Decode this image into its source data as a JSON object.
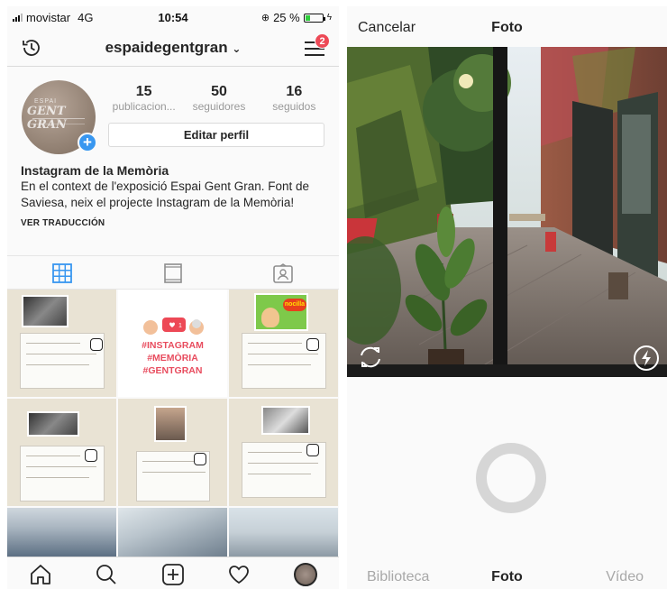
{
  "status_bar": {
    "carrier": "movistar",
    "network": "4G",
    "time": "10:54",
    "battery_percent": "25 %",
    "battery_level": 0.25
  },
  "profile": {
    "username": "espaidegentgran",
    "notification_count": "2",
    "avatar_text_top": "ESPAI",
    "avatar_text_main": "GENT GRAN",
    "stats": [
      {
        "count": "15",
        "label": "publicacion..."
      },
      {
        "count": "50",
        "label": "seguidores"
      },
      {
        "count": "16",
        "label": "seguidos"
      }
    ],
    "edit_button": "Editar perfil",
    "display_name": "Instagram de la Memòria",
    "bio": "En el context de l'exposició Espai Gent Gran. Font de Saviesa, neix el projecte Instagram de la Memòria!",
    "translate_link": "VER TRADUCCIÓN"
  },
  "grid": {
    "post_hashtags": [
      "#INSTAGRAM",
      "#MEMÒRIA",
      "#GENTGRAN"
    ],
    "post_like_count": "1",
    "sticker_text": "nocilla"
  },
  "camera": {
    "cancel": "Cancelar",
    "title": "Foto",
    "tabs": [
      "Biblioteca",
      "Foto",
      "Vídeo"
    ],
    "active_tab": "Foto"
  },
  "colors": {
    "accent_blue": "#3897f0",
    "badge_red": "#ed4956",
    "hashtag_red": "#e84c5e",
    "grid_blue": "#3897f0"
  }
}
